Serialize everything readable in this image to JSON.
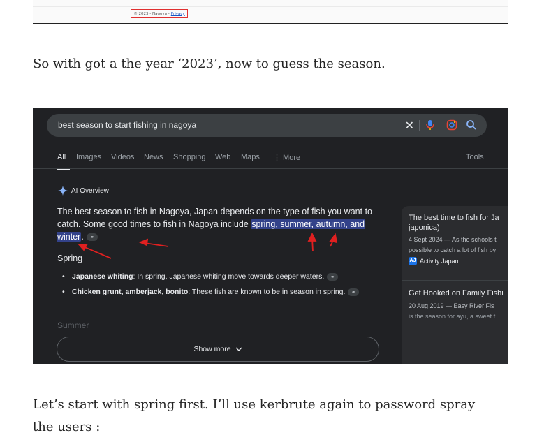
{
  "top_footer": {
    "copyright": "© 2023 - Nagoya -",
    "privacy_link": "Privacy"
  },
  "paragraph_1": "So with got a the year ‘2023’, now to guess the season.",
  "search": {
    "query": "best season to start fishing in nagoya",
    "tabs": [
      "All",
      "Images",
      "Videos",
      "News",
      "Shopping",
      "Web",
      "Maps",
      "⋮ More"
    ],
    "tools": "Tools"
  },
  "ai_overview": {
    "heading": "AI Overview",
    "text_part1": "The best season to fish in Nagoya, Japan depends on the type of fish you want to catch. Some good times to fish in Nagoya include ",
    "highlight": "spring, summer, autumn, and winter",
    "text_end": ".",
    "section_heading": "Spring",
    "bullets": [
      {
        "bold": "Japanese whiting",
        "text": ": In spring, Japanese whiting move towards deeper waters."
      },
      {
        "bold": "Chicken grunt, amberjack, bonito",
        "text": ": These fish are known to be in season in spring."
      }
    ],
    "ghost_heading": "Summer",
    "show_more": "Show more"
  },
  "side_results": [
    {
      "title_line1": "The best time to fish for Ja",
      "title_line2": "japonica)",
      "meta_line1": "4 Sept 2024 — As the schools t",
      "meta_line2": "possible to catch a lot of fish by",
      "source": "Activity Japan"
    },
    {
      "title_line1": "Get Hooked on Family Fishi",
      "meta_line1": "20 Aug 2019 — Easy River Fis",
      "meta_line2": "is the season for ayu, a sweet f"
    }
  ],
  "paragraph_2": "Let’s start with spring first. I’ll use kerbrute again to password spray the users :",
  "colors": {
    "highlight_bg": "#33428a",
    "annotation_red": "#e02020",
    "dark_bg": "#202124"
  }
}
